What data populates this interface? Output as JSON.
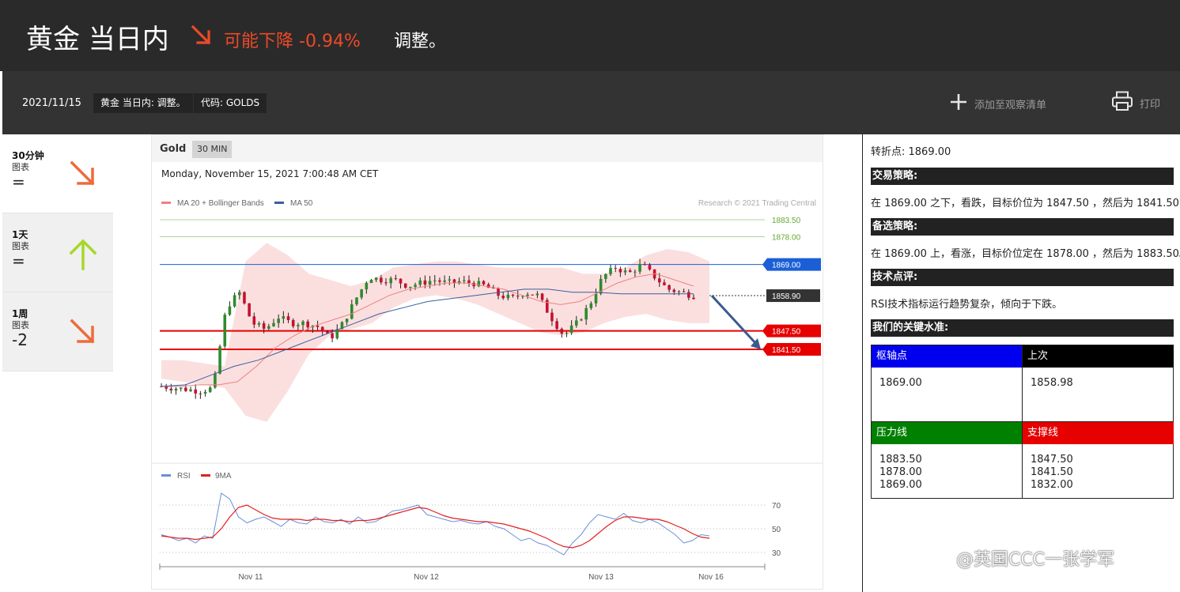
{
  "header": {
    "title": "黄金 当日内",
    "direction": "可能下降",
    "change": "-0.94%",
    "status": "调整。",
    "arrow_icon": "arrow-down-right-icon",
    "accent_color": "#ec4a28"
  },
  "toolbar": {
    "date": "2021/11/15",
    "tag_title": "黄金 当日内: 调整。",
    "tag_code": "代码: GOLDS",
    "watchlist_label": "添加至观察清单",
    "watchlist_icon": "plus-icon",
    "print_label": "打印",
    "print_icon": "printer-icon"
  },
  "timeframes": [
    {
      "name": "30分钟",
      "sub": "图表",
      "score": "=",
      "direction": "down",
      "icon": "arrow-down-right-icon"
    },
    {
      "name": "1天",
      "sub": "图表",
      "score": "=",
      "direction": "up",
      "icon": "arrow-up-icon"
    },
    {
      "name": "1周",
      "sub": "图表",
      "score": "-2",
      "direction": "down",
      "icon": "arrow-down-right-icon"
    }
  ],
  "chart_header": {
    "instrument": "Gold",
    "interval": "30 MIN",
    "timestamp": "Monday, November 15, 2021 7:00:48 AM CET",
    "credit": "Research © 2021 Trading Central"
  },
  "chart_data": [
    {
      "type": "line",
      "title": "",
      "legend": [
        {
          "name": "MA 20 + Bollinger Bands",
          "color": "#f08080"
        },
        {
          "name": "MA 50",
          "color": "#3a5fa0"
        }
      ],
      "x_ticks": [
        "Nov 11",
        "Nov 12",
        "Nov 13",
        "Nov 16"
      ],
      "levels": [
        {
          "value": 1883.5,
          "label": "1883.50",
          "style": "resistance-minor",
          "color": "#64a832"
        },
        {
          "value": 1878.0,
          "label": "1878.00",
          "style": "resistance-minor",
          "color": "#64a832"
        },
        {
          "value": 1869.0,
          "label": "1869.00",
          "style": "pivot",
          "color": "#1a5fd6"
        },
        {
          "value": 1858.9,
          "label": "1858.90",
          "style": "last",
          "color": "#333333"
        },
        {
          "value": 1847.5,
          "label": "1847.50",
          "style": "support",
          "color": "#e60000"
        },
        {
          "value": 1841.5,
          "label": "1841.50",
          "style": "support",
          "color": "#e60000"
        }
      ],
      "ylim": [
        1827,
        1890
      ],
      "price_path": [
        1829.5,
        1829.0,
        1828.5,
        1828.0,
        1829.0,
        1855.0,
        1860.0,
        1850.0,
        1848.0,
        1852.0,
        1850.0,
        1850.0,
        1849.0,
        1845.0,
        1850.0,
        1858.0,
        1865.0,
        1864.0,
        1864.0,
        1862.0,
        1863.0,
        1864.0,
        1863.0,
        1863.5,
        1863.0,
        1862.0,
        1859.0,
        1858.0,
        1860.0,
        1859.0,
        1852.0,
        1846.0,
        1850.0,
        1856.0,
        1865.0,
        1868.0,
        1866.0,
        1869.0,
        1865.0,
        1861.0,
        1860.0,
        1858.9
      ],
      "ma20_path": [
        1829.5,
        1829.5,
        1830.0,
        1830.0,
        1831.0,
        1836.0,
        1842.0,
        1846.0,
        1849.0,
        1851.0,
        1853.0,
        1856.0,
        1859.0,
        1861.0,
        1862.0,
        1863.0,
        1863.0,
        1862.0,
        1861.0,
        1859.0,
        1857.0,
        1856.0,
        1857.0,
        1860.0,
        1863.0,
        1865.0,
        1866.0,
        1864.0,
        1862.0
      ],
      "ma50_path": [
        1829.5,
        1830.0,
        1833.0,
        1836.0,
        1838.0,
        1841.0,
        1844.0,
        1847.0,
        1850.0,
        1853.0,
        1855.0,
        1857.0,
        1858.0,
        1859.0,
        1860.0,
        1861.0,
        1861.0,
        1860.0,
        1860.0,
        1859.5,
        1859.5,
        1859.5,
        1859.5
      ],
      "projection": {
        "from": 1858.9,
        "to": 1841.5
      }
    },
    {
      "type": "line",
      "title": "",
      "legend": [
        {
          "name": "RSI",
          "color": "#6a8fd8"
        },
        {
          "name": "9MA",
          "color": "#e02020"
        }
      ],
      "y_ticks": [
        70,
        50,
        30
      ],
      "ylim": [
        20,
        85
      ],
      "series": [
        {
          "name": "RSI",
          "values": [
            45,
            43,
            40,
            42,
            38,
            44,
            42,
            80,
            75,
            60,
            55,
            58,
            60,
            56,
            52,
            58,
            55,
            54,
            60,
            56,
            55,
            58,
            54,
            60,
            55,
            56,
            60,
            65,
            66,
            68,
            70,
            62,
            60,
            58,
            56,
            57,
            55,
            54,
            56,
            52,
            50,
            45,
            40,
            42,
            38,
            36,
            32,
            28,
            38,
            45,
            55,
            62,
            60,
            58,
            63,
            57,
            55,
            58,
            55,
            50,
            45,
            38,
            40,
            45,
            44
          ]
        },
        {
          "name": "9MA",
          "values": [
            44,
            43,
            42,
            42,
            41,
            42,
            43,
            50,
            60,
            68,
            70,
            66,
            62,
            59,
            58,
            58,
            58,
            57,
            58,
            58,
            57,
            57,
            56,
            57,
            57,
            58,
            60,
            62,
            64,
            66,
            68,
            67,
            64,
            61,
            59,
            58,
            57,
            56,
            56,
            55,
            54,
            52,
            50,
            48,
            45,
            42,
            38,
            35,
            34,
            36,
            40,
            46,
            52,
            57,
            60,
            60,
            59,
            58,
            58,
            56,
            53,
            50,
            46,
            43,
            42
          ]
        }
      ]
    }
  ],
  "analysis": {
    "pivot_line": "转折点: 1869.00",
    "strategy_title": "交易策略:",
    "strategy_text": "在 1869.00 之下，看跌，目标价位为 1847.50 ，然后为 1841.50 。",
    "alt_title": "备选策略:",
    "alt_text": "在 1869.00 上，看涨，目标价位定在 1878.00 ，然后为 1883.50。",
    "tech_title": "技术点评:",
    "tech_text": "RSI技术指标运行趋势复杂，倾向于下跌。",
    "key_title": "我们的关键水准:"
  },
  "key_levels": {
    "pivot": {
      "label": "枢轴点",
      "values": [
        "1869.00"
      ],
      "color": "#0000ee"
    },
    "last": {
      "label": "上次",
      "values": [
        "1858.98"
      ],
      "color": "#000000"
    },
    "resistance": {
      "label": "压力线",
      "values": [
        "1883.50",
        "1878.00",
        "1869.00"
      ],
      "color": "#008000"
    },
    "support": {
      "label": "支撑线",
      "values": [
        "1847.50",
        "1841.50",
        "1832.00"
      ],
      "color": "#e60000"
    }
  },
  "watermark": "@英国CCC一张学军"
}
